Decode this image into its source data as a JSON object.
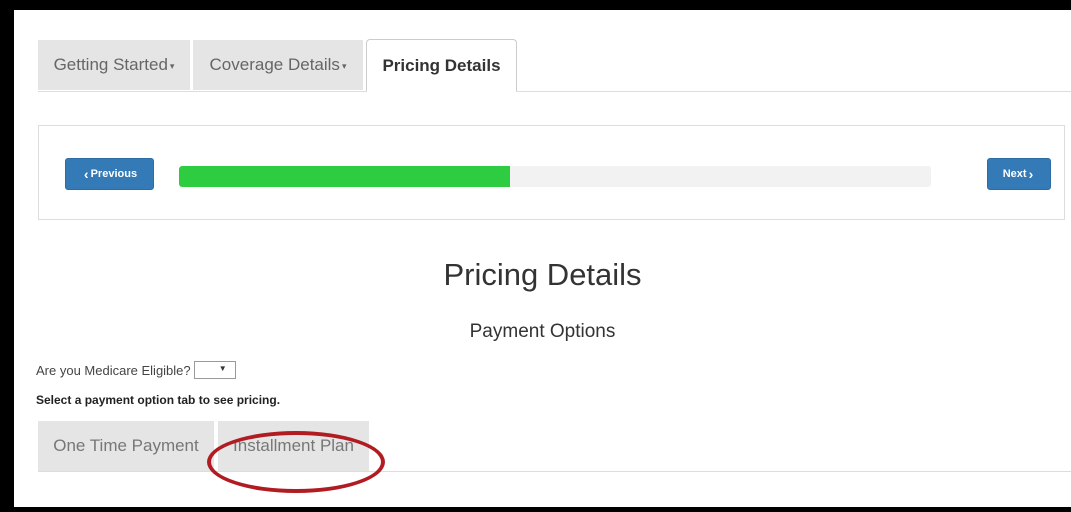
{
  "tabs": [
    {
      "label": "Getting Started"
    },
    {
      "label": "Coverage Details"
    },
    {
      "label": "Pricing Details"
    }
  ],
  "wizard": {
    "previous_label": "Previous",
    "next_label": "Next",
    "progress": 0.44,
    "progress_color": "#2ecc40",
    "button_color": "#337ab7"
  },
  "page": {
    "title": "Pricing Details",
    "subtitle": "Payment Options"
  },
  "medicare": {
    "label": "Are you Medicare Eligible?",
    "value": ""
  },
  "instruction": "Select a payment option tab to see pricing.",
  "payment_tabs": [
    {
      "label": "One Time Payment"
    },
    {
      "label": "Installment Plan"
    }
  ],
  "annotation": {
    "color": "#b01c22",
    "icon": "red-circle"
  }
}
